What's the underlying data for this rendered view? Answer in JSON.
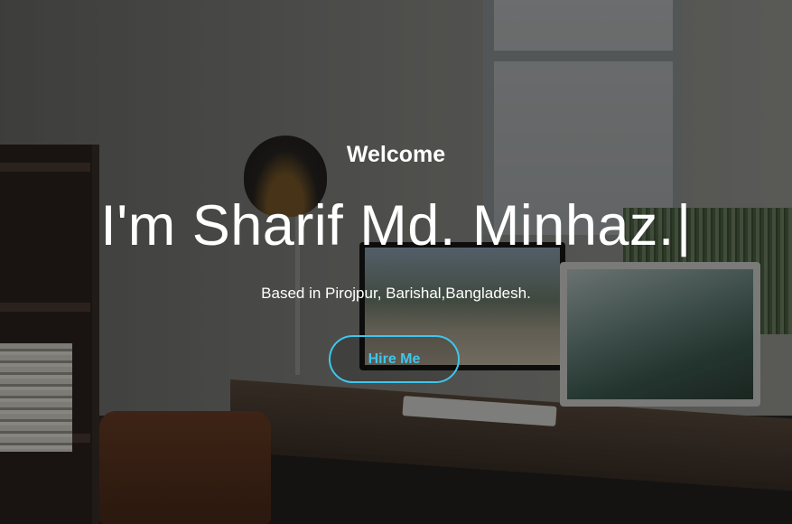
{
  "hero": {
    "greeting": "Welcome",
    "headline": "I'm Sharif Md. Minhaz.",
    "cursor": "|",
    "tagline": "Based in Pirojpur, Barishal,Bangladesh.",
    "cta_label": "Hire Me"
  },
  "colors": {
    "accent": "#3fc6ec",
    "text": "#ffffff",
    "overlay": "rgba(0,0,0,0.42)"
  },
  "background": {
    "icon": "office-desk-photo"
  }
}
